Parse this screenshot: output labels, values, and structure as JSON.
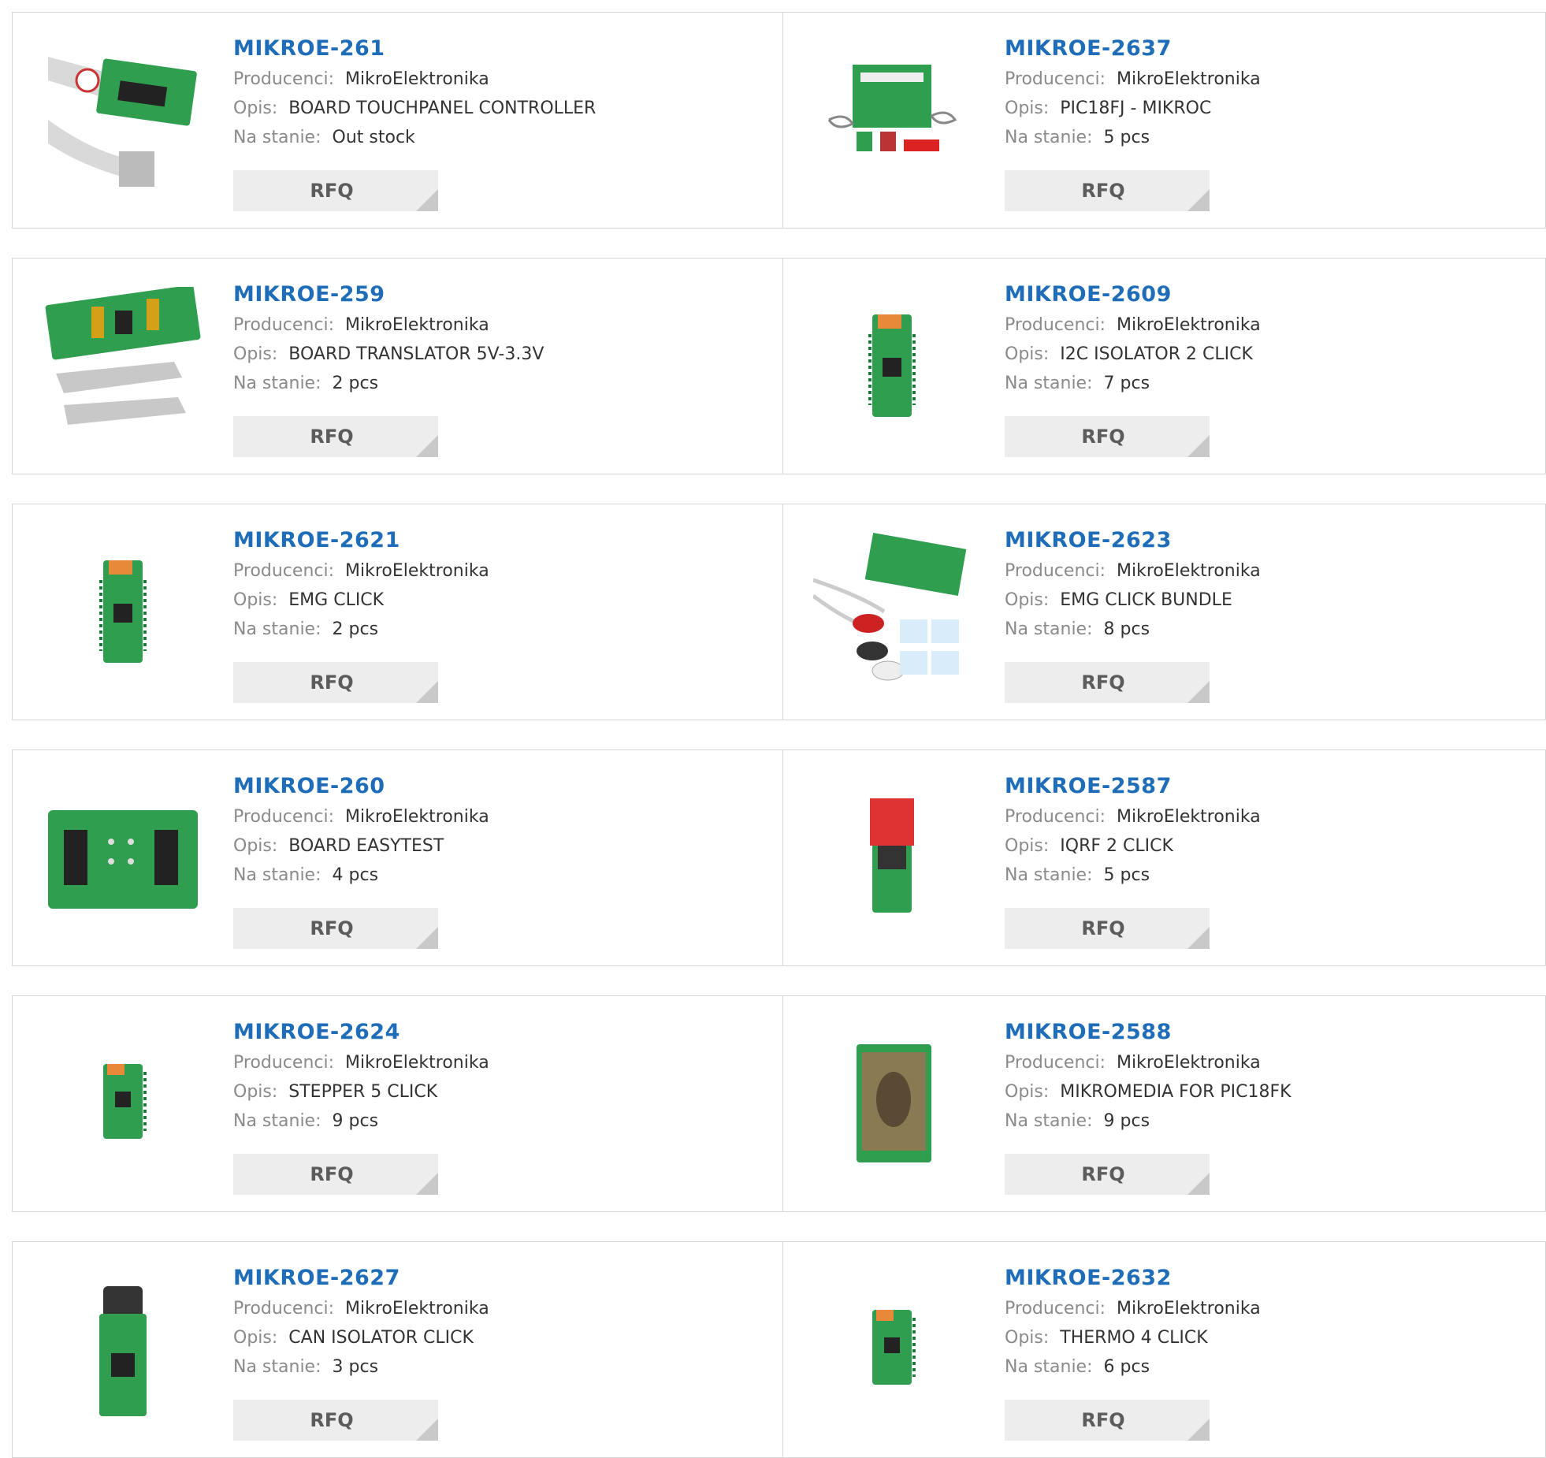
{
  "labels": {
    "manufacturer": "Producenci:",
    "description": "Opis:",
    "stock": "Na stanie:",
    "rfq": "RFQ"
  },
  "colors": {
    "part_link": "#1f6db8",
    "label_gray": "#8a8a8a",
    "button_bg": "#ededed",
    "border": "#d5d5d5"
  },
  "products": [
    {
      "pn": "MIKROE-261",
      "manufacturer": "MikroElektronika",
      "description": "BOARD TOUCHPANEL CONTROLLER",
      "stock": "Out stock",
      "image": "touchpanel-board-with-ribbon-cable"
    },
    {
      "pn": "MIKROE-2637",
      "manufacturer": "MikroElektronika",
      "description": "PIC18FJ - MIKROC",
      "stock": "5 pcs",
      "image": "development-board-kit"
    },
    {
      "pn": "MIKROE-259",
      "manufacturer": "MikroElektronika",
      "description": "BOARD TRANSLATOR 5V-3.3V",
      "stock": "2 pcs",
      "image": "translator-board-with-cables"
    },
    {
      "pn": "MIKROE-2609",
      "manufacturer": "MikroElektronika",
      "description": "I2C ISOLATOR 2 CLICK",
      "stock": "7 pcs",
      "image": "click-board"
    },
    {
      "pn": "MIKROE-2621",
      "manufacturer": "MikroElektronika",
      "description": "EMG CLICK",
      "stock": "2 pcs",
      "image": "click-board"
    },
    {
      "pn": "MIKROE-2623",
      "manufacturer": "MikroElektronika",
      "description": "EMG CLICK BUNDLE",
      "stock": "8 pcs",
      "image": "emg-bundle-with-electrodes"
    },
    {
      "pn": "MIKROE-260",
      "manufacturer": "MikroElektronika",
      "description": "BOARD EASYTEST",
      "stock": "4 pcs",
      "image": "easytest-board"
    },
    {
      "pn": "MIKROE-2587",
      "manufacturer": "MikroElektronika",
      "description": "IQRF 2 CLICK",
      "stock": "5 pcs",
      "image": "click-board-red-module"
    },
    {
      "pn": "MIKROE-2624",
      "manufacturer": "MikroElektronika",
      "description": "STEPPER 5 CLICK",
      "stock": "9 pcs",
      "image": "click-board-small"
    },
    {
      "pn": "MIKROE-2588",
      "manufacturer": "MikroElektronika",
      "description": "MIKROMEDIA FOR PIC18FK",
      "stock": "9 pcs",
      "image": "mikromedia-display-board"
    },
    {
      "pn": "MIKROE-2627",
      "manufacturer": "MikroElektronika",
      "description": "CAN ISOLATOR CLICK",
      "stock": "3 pcs",
      "image": "click-board-db9"
    },
    {
      "pn": "MIKROE-2632",
      "manufacturer": "MikroElektronika",
      "description": "THERMO 4 CLICK",
      "stock": "6 pcs",
      "image": "click-board-small"
    }
  ]
}
